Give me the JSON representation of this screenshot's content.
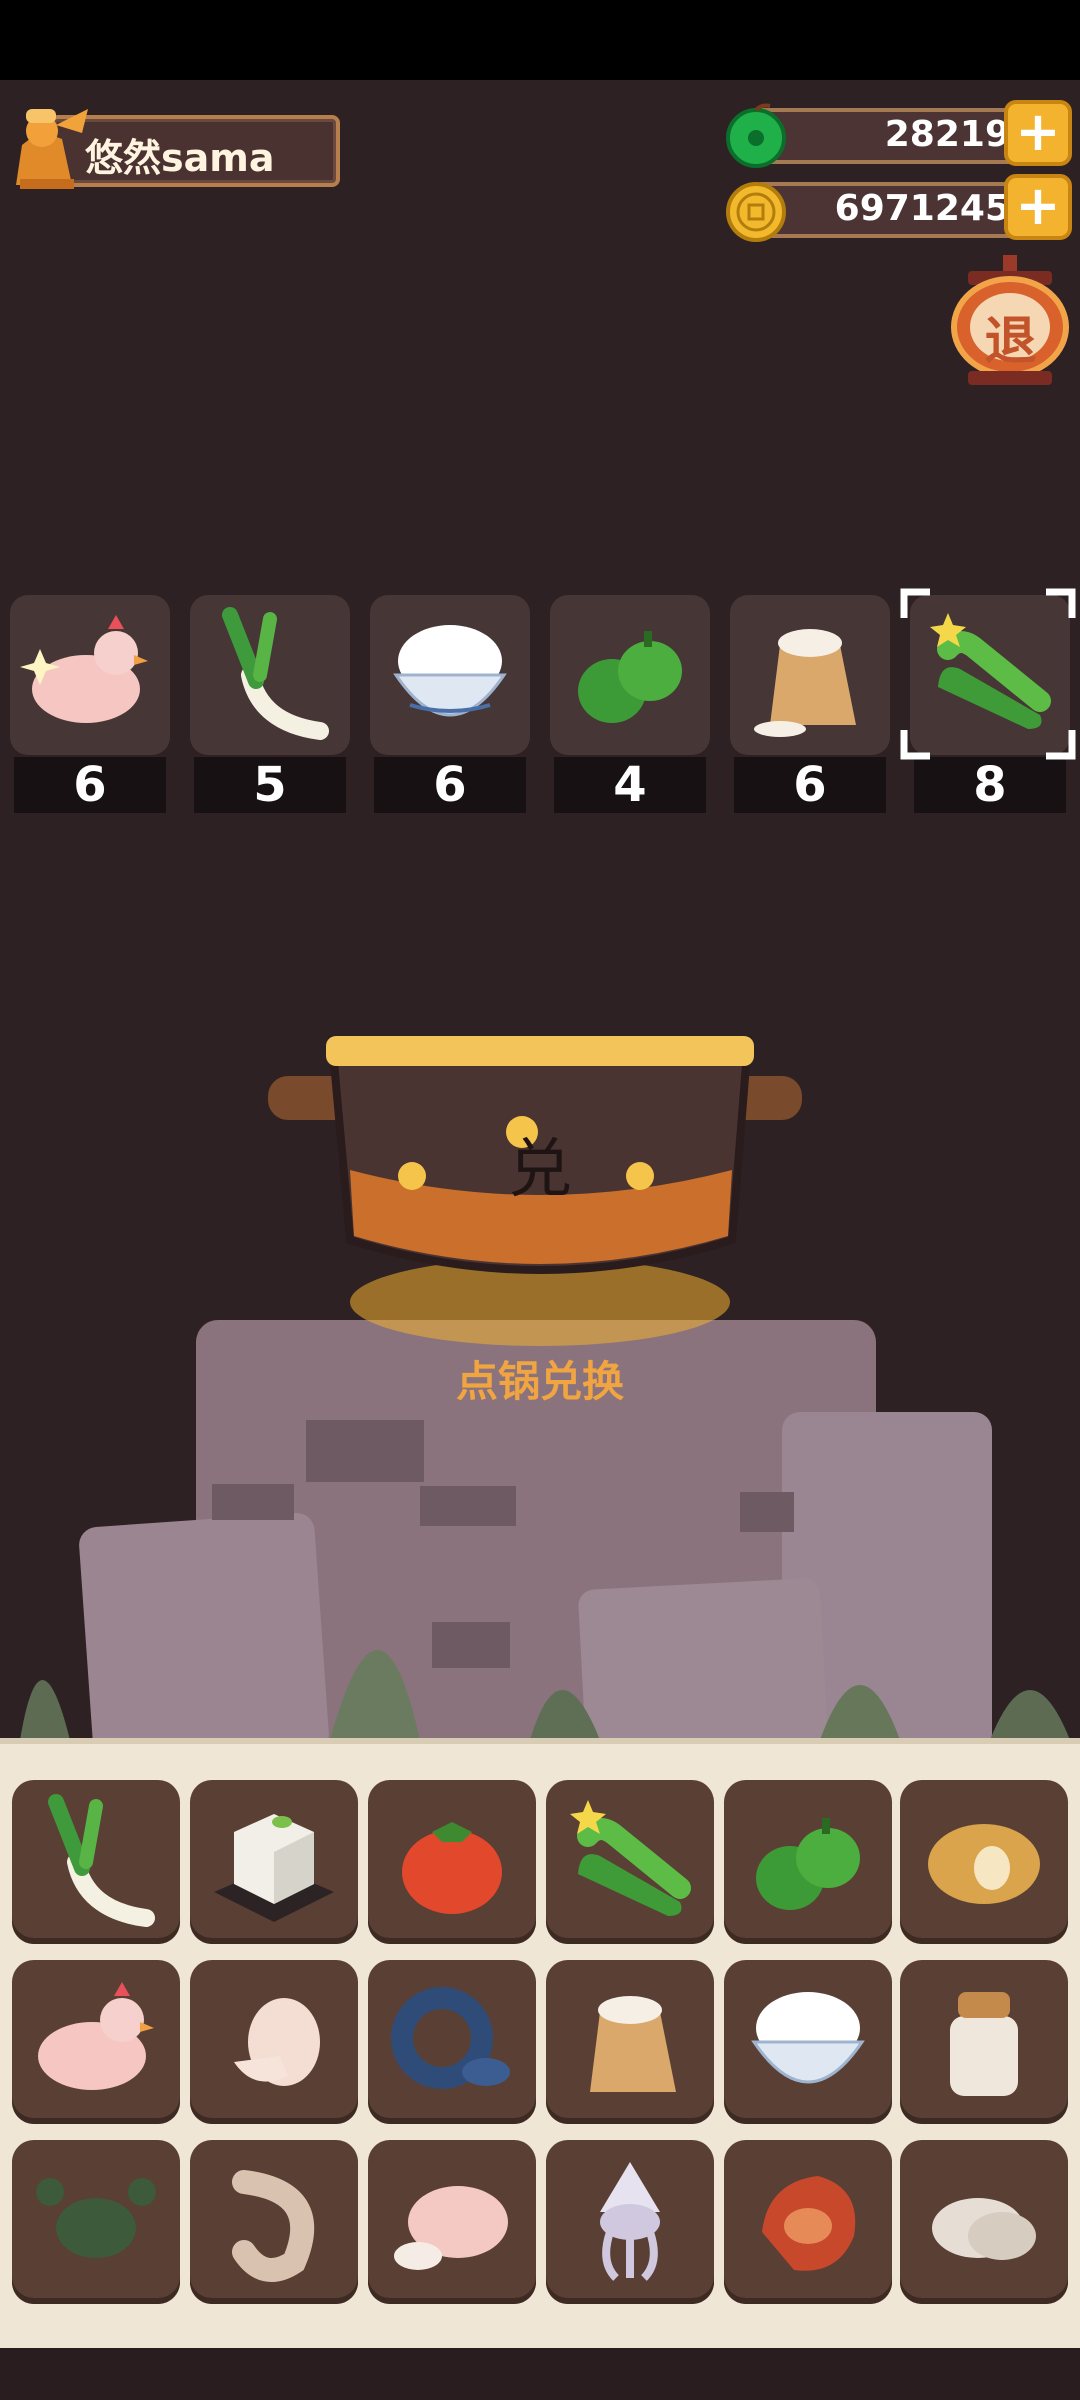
{
  "player": {
    "name": "悠然sama"
  },
  "currency": {
    "jade": {
      "value": "28219",
      "icon": "jade-icon"
    },
    "coins": {
      "value": "6971245",
      "icon": "coin-icon"
    },
    "add_label": "+"
  },
  "exit_label": "退",
  "recipe": [
    {
      "item": "chicken",
      "count": "6"
    },
    {
      "item": "leek",
      "count": "5"
    },
    {
      "item": "rice",
      "count": "6"
    },
    {
      "item": "green-pepper",
      "count": "4"
    },
    {
      "item": "flour",
      "count": "6"
    },
    {
      "item": "cucumber",
      "count": "8",
      "selected": true
    }
  ],
  "pot": {
    "glyph": "兑",
    "label": "点锅兑换"
  },
  "inventory": [
    "leek",
    "tofu",
    "tomato",
    "cucumber",
    "green-pepper",
    "potato",
    "chicken",
    "egg",
    "eel",
    "flour",
    "rice",
    "sauce-jar",
    "crab",
    "shrimp",
    "duck",
    "squid",
    "meat",
    "clam"
  ]
}
